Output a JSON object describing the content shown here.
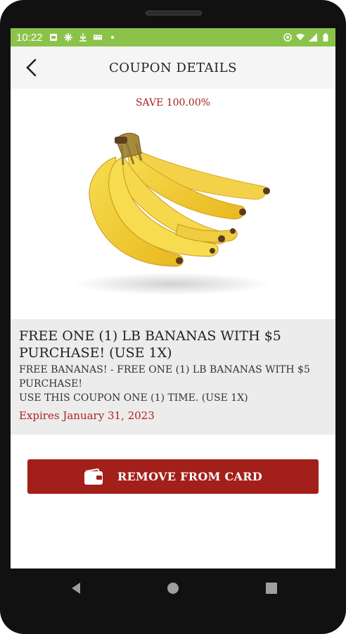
{
  "status_bar": {
    "time": "10:22",
    "icons_left": [
      "sim-icon",
      "grid-icon",
      "usb-icon",
      "keyboard-icon",
      "dot-icon"
    ],
    "icons_right": [
      "vpn-icon",
      "wifi-icon",
      "signal-icon",
      "battery-icon"
    ],
    "bg_color": "#8bc34a"
  },
  "header": {
    "title": "COUPON DETAILS",
    "back_icon": "chevron-left-icon"
  },
  "coupon": {
    "save_text": "SAVE 100.00%",
    "image": "bananas-image",
    "headline": "FREE ONE (1) LB BANANAS WITH $5 PURCHASE! (USE 1X)",
    "description": "FREE BANANAS! - FREE ONE (1) LB BANANAS WITH $5 PURCHASE!\nUSE THIS COUPON ONE (1) TIME. (USE 1X)",
    "expires": "Expires January 31, 2023"
  },
  "action": {
    "label": "REMOVE FROM CARD",
    "icon": "wallet-icon",
    "color": "#a3201a"
  },
  "nav": {
    "icons": [
      "back-triangle-icon",
      "home-circle-icon",
      "recents-square-icon"
    ]
  }
}
